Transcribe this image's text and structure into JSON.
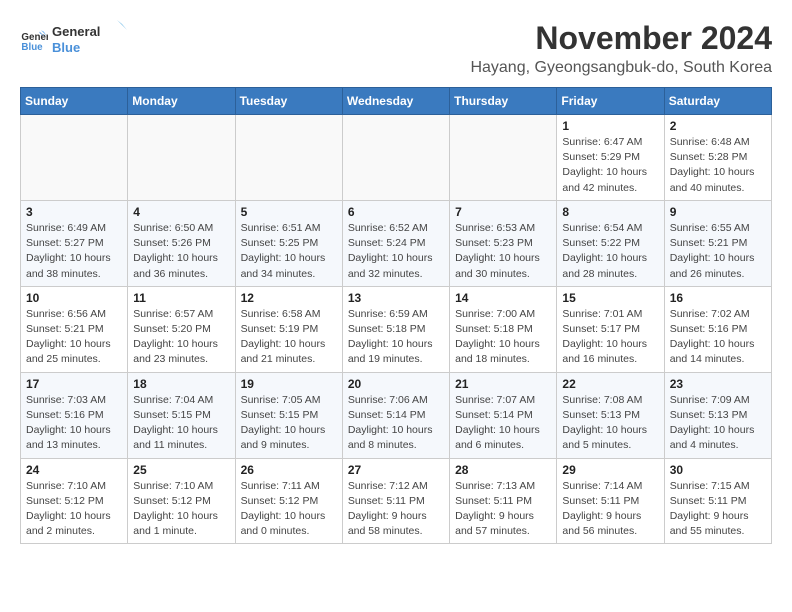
{
  "logo": {
    "line1": "General",
    "line2": "Blue"
  },
  "title": "November 2024",
  "subtitle": "Hayang, Gyeongsangbuk-do, South Korea",
  "weekdays": [
    "Sunday",
    "Monday",
    "Tuesday",
    "Wednesday",
    "Thursday",
    "Friday",
    "Saturday"
  ],
  "weeks": [
    [
      {
        "day": "",
        "info": ""
      },
      {
        "day": "",
        "info": ""
      },
      {
        "day": "",
        "info": ""
      },
      {
        "day": "",
        "info": ""
      },
      {
        "day": "",
        "info": ""
      },
      {
        "day": "1",
        "info": "Sunrise: 6:47 AM\nSunset: 5:29 PM\nDaylight: 10 hours and 42 minutes."
      },
      {
        "day": "2",
        "info": "Sunrise: 6:48 AM\nSunset: 5:28 PM\nDaylight: 10 hours and 40 minutes."
      }
    ],
    [
      {
        "day": "3",
        "info": "Sunrise: 6:49 AM\nSunset: 5:27 PM\nDaylight: 10 hours and 38 minutes."
      },
      {
        "day": "4",
        "info": "Sunrise: 6:50 AM\nSunset: 5:26 PM\nDaylight: 10 hours and 36 minutes."
      },
      {
        "day": "5",
        "info": "Sunrise: 6:51 AM\nSunset: 5:25 PM\nDaylight: 10 hours and 34 minutes."
      },
      {
        "day": "6",
        "info": "Sunrise: 6:52 AM\nSunset: 5:24 PM\nDaylight: 10 hours and 32 minutes."
      },
      {
        "day": "7",
        "info": "Sunrise: 6:53 AM\nSunset: 5:23 PM\nDaylight: 10 hours and 30 minutes."
      },
      {
        "day": "8",
        "info": "Sunrise: 6:54 AM\nSunset: 5:22 PM\nDaylight: 10 hours and 28 minutes."
      },
      {
        "day": "9",
        "info": "Sunrise: 6:55 AM\nSunset: 5:21 PM\nDaylight: 10 hours and 26 minutes."
      }
    ],
    [
      {
        "day": "10",
        "info": "Sunrise: 6:56 AM\nSunset: 5:21 PM\nDaylight: 10 hours and 25 minutes."
      },
      {
        "day": "11",
        "info": "Sunrise: 6:57 AM\nSunset: 5:20 PM\nDaylight: 10 hours and 23 minutes."
      },
      {
        "day": "12",
        "info": "Sunrise: 6:58 AM\nSunset: 5:19 PM\nDaylight: 10 hours and 21 minutes."
      },
      {
        "day": "13",
        "info": "Sunrise: 6:59 AM\nSunset: 5:18 PM\nDaylight: 10 hours and 19 minutes."
      },
      {
        "day": "14",
        "info": "Sunrise: 7:00 AM\nSunset: 5:18 PM\nDaylight: 10 hours and 18 minutes."
      },
      {
        "day": "15",
        "info": "Sunrise: 7:01 AM\nSunset: 5:17 PM\nDaylight: 10 hours and 16 minutes."
      },
      {
        "day": "16",
        "info": "Sunrise: 7:02 AM\nSunset: 5:16 PM\nDaylight: 10 hours and 14 minutes."
      }
    ],
    [
      {
        "day": "17",
        "info": "Sunrise: 7:03 AM\nSunset: 5:16 PM\nDaylight: 10 hours and 13 minutes."
      },
      {
        "day": "18",
        "info": "Sunrise: 7:04 AM\nSunset: 5:15 PM\nDaylight: 10 hours and 11 minutes."
      },
      {
        "day": "19",
        "info": "Sunrise: 7:05 AM\nSunset: 5:15 PM\nDaylight: 10 hours and 9 minutes."
      },
      {
        "day": "20",
        "info": "Sunrise: 7:06 AM\nSunset: 5:14 PM\nDaylight: 10 hours and 8 minutes."
      },
      {
        "day": "21",
        "info": "Sunrise: 7:07 AM\nSunset: 5:14 PM\nDaylight: 10 hours and 6 minutes."
      },
      {
        "day": "22",
        "info": "Sunrise: 7:08 AM\nSunset: 5:13 PM\nDaylight: 10 hours and 5 minutes."
      },
      {
        "day": "23",
        "info": "Sunrise: 7:09 AM\nSunset: 5:13 PM\nDaylight: 10 hours and 4 minutes."
      }
    ],
    [
      {
        "day": "24",
        "info": "Sunrise: 7:10 AM\nSunset: 5:12 PM\nDaylight: 10 hours and 2 minutes."
      },
      {
        "day": "25",
        "info": "Sunrise: 7:10 AM\nSunset: 5:12 PM\nDaylight: 10 hours and 1 minute."
      },
      {
        "day": "26",
        "info": "Sunrise: 7:11 AM\nSunset: 5:12 PM\nDaylight: 10 hours and 0 minutes."
      },
      {
        "day": "27",
        "info": "Sunrise: 7:12 AM\nSunset: 5:11 PM\nDaylight: 9 hours and 58 minutes."
      },
      {
        "day": "28",
        "info": "Sunrise: 7:13 AM\nSunset: 5:11 PM\nDaylight: 9 hours and 57 minutes."
      },
      {
        "day": "29",
        "info": "Sunrise: 7:14 AM\nSunset: 5:11 PM\nDaylight: 9 hours and 56 minutes."
      },
      {
        "day": "30",
        "info": "Sunrise: 7:15 AM\nSunset: 5:11 PM\nDaylight: 9 hours and 55 minutes."
      }
    ]
  ]
}
